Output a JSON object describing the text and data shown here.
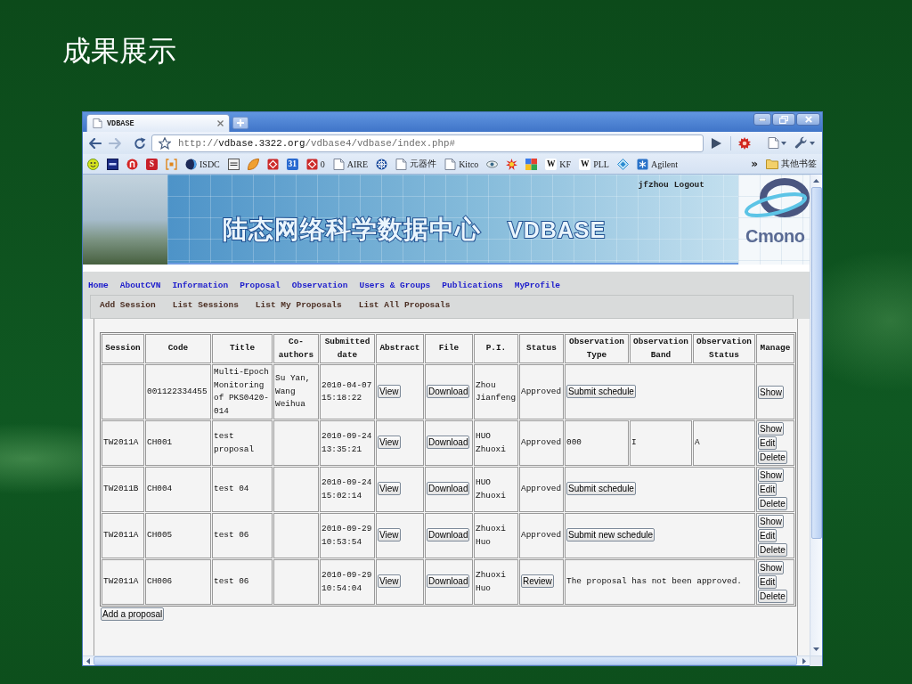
{
  "slide": {
    "title": "成果展示"
  },
  "browser": {
    "tabs": [
      {
        "label": "VDBASE",
        "selected": true
      }
    ],
    "can_go_back": true,
    "can_go_forward": false,
    "url": {
      "scheme": "http://",
      "host": "vdbase.3322.org",
      "path": "/vdbase4/vdbase/index.php#"
    },
    "bookmarks": [
      {
        "kind": "icon"
      },
      {
        "kind": "icon"
      },
      {
        "kind": "icon"
      },
      {
        "kind": "glyph",
        "glyph": "S",
        "color": "#c8202a"
      },
      {
        "kind": "icon"
      },
      {
        "kind": "icon",
        "label": "ISDC"
      },
      {
        "kind": "icon"
      },
      {
        "kind": "icon"
      },
      {
        "kind": "icon"
      },
      {
        "kind": "glyph",
        "glyph": "31",
        "color": "#2a6ad0"
      },
      {
        "kind": "icon",
        "label": "0"
      },
      {
        "kind": "icon",
        "label": "AIRE"
      },
      {
        "kind": "icon"
      },
      {
        "kind": "icon",
        "label": "元器件"
      },
      {
        "kind": "icon",
        "label": "Kitco"
      },
      {
        "kind": "icon"
      },
      {
        "kind": "icon"
      },
      {
        "kind": "icon"
      },
      {
        "kind": "glyph",
        "glyph": "W",
        "color": "#ffffff",
        "label": "KF"
      },
      {
        "kind": "glyph",
        "glyph": "W",
        "color": "#ffffff",
        "label": "PLL"
      },
      {
        "kind": "icon"
      },
      {
        "kind": "icon",
        "label": "Agilent"
      }
    ],
    "bookmarks_overflow": "»",
    "other_bookmarks": "其他书签"
  },
  "page": {
    "banner": {
      "title": "陆态网络科学数据中心",
      "brand": "VDBASE",
      "user": "jfzhou",
      "logout": "Logout",
      "logo_text": "Cmono"
    },
    "nav": [
      "Home",
      "AboutCVN",
      "Information",
      "Proposal",
      "Observation",
      "Users & Groups",
      "Publications",
      "MyProfile"
    ],
    "subnav": [
      "Add Session",
      "List Sessions",
      "List My Proposals",
      "List All Proposals"
    ],
    "table": {
      "columns": [
        "Session",
        "Code",
        "Title",
        "Co-authors",
        "Submitted date",
        "Abstract",
        "File",
        "P.I.",
        "Status",
        "Observation Type",
        "Observation Band",
        "Observation Status",
        "Manage"
      ],
      "rows": [
        {
          "code": "001122334455",
          "title": "Multi-Epoch Monitoring of PKS0420-014",
          "co_authors": "Su Yan, Wang Weihua",
          "submitted": "2010-04-07 15:18:22",
          "abstract": "View",
          "file": "Download",
          "pi": "Zhou Jianfeng",
          "status": {
            "kind": "text",
            "label": "Approved"
          },
          "observation": {
            "kind": "button",
            "label": "Submit schedule"
          },
          "manage": [
            "Show"
          ]
        },
        {
          "session": "TW2011A",
          "code": "CH001",
          "title": "test proposal",
          "submitted": "2010-09-24 13:35:21",
          "abstract": "View",
          "file": "Download",
          "pi": "HUO Zhuoxi",
          "status": {
            "kind": "text",
            "label": "Approved"
          },
          "observation": {
            "kind": "values",
            "type": "000",
            "band": "I",
            "status": "A"
          },
          "manage": [
            "Show",
            "Edit",
            "Delete"
          ]
        },
        {
          "session": "TW2011B",
          "code": "CH004",
          "title": "test 04",
          "submitted": "2010-09-24 15:02:14",
          "abstract": "View",
          "file": "Download",
          "pi": "HUO Zhuoxi",
          "status": {
            "kind": "text",
            "label": "Approved"
          },
          "observation": {
            "kind": "button",
            "label": "Submit schedule"
          },
          "manage": [
            "Show",
            "Edit",
            "Delete"
          ]
        },
        {
          "session": "TW2011A",
          "code": "CH005",
          "title": "test 06",
          "submitted": "2010-09-29 10:53:54",
          "abstract": "View",
          "file": "Download",
          "pi": "Zhuoxi Huo",
          "status": {
            "kind": "text",
            "label": "Approved"
          },
          "observation": {
            "kind": "button",
            "label": "Submit new schedule"
          },
          "manage": [
            "Show",
            "Edit",
            "Delete"
          ]
        },
        {
          "session": "TW2011A",
          "code": "CH006",
          "title": "test 06",
          "submitted": "2010-09-29 10:54:04",
          "abstract": "View",
          "file": "Download",
          "pi": "Zhuoxi Huo",
          "status": {
            "kind": "button",
            "label": "Review"
          },
          "observation": {
            "kind": "text",
            "label": "The proposal has not been approved."
          },
          "manage": [
            "Show",
            "Edit",
            "Delete"
          ]
        }
      ]
    },
    "add_button": "Add a proposal"
  }
}
